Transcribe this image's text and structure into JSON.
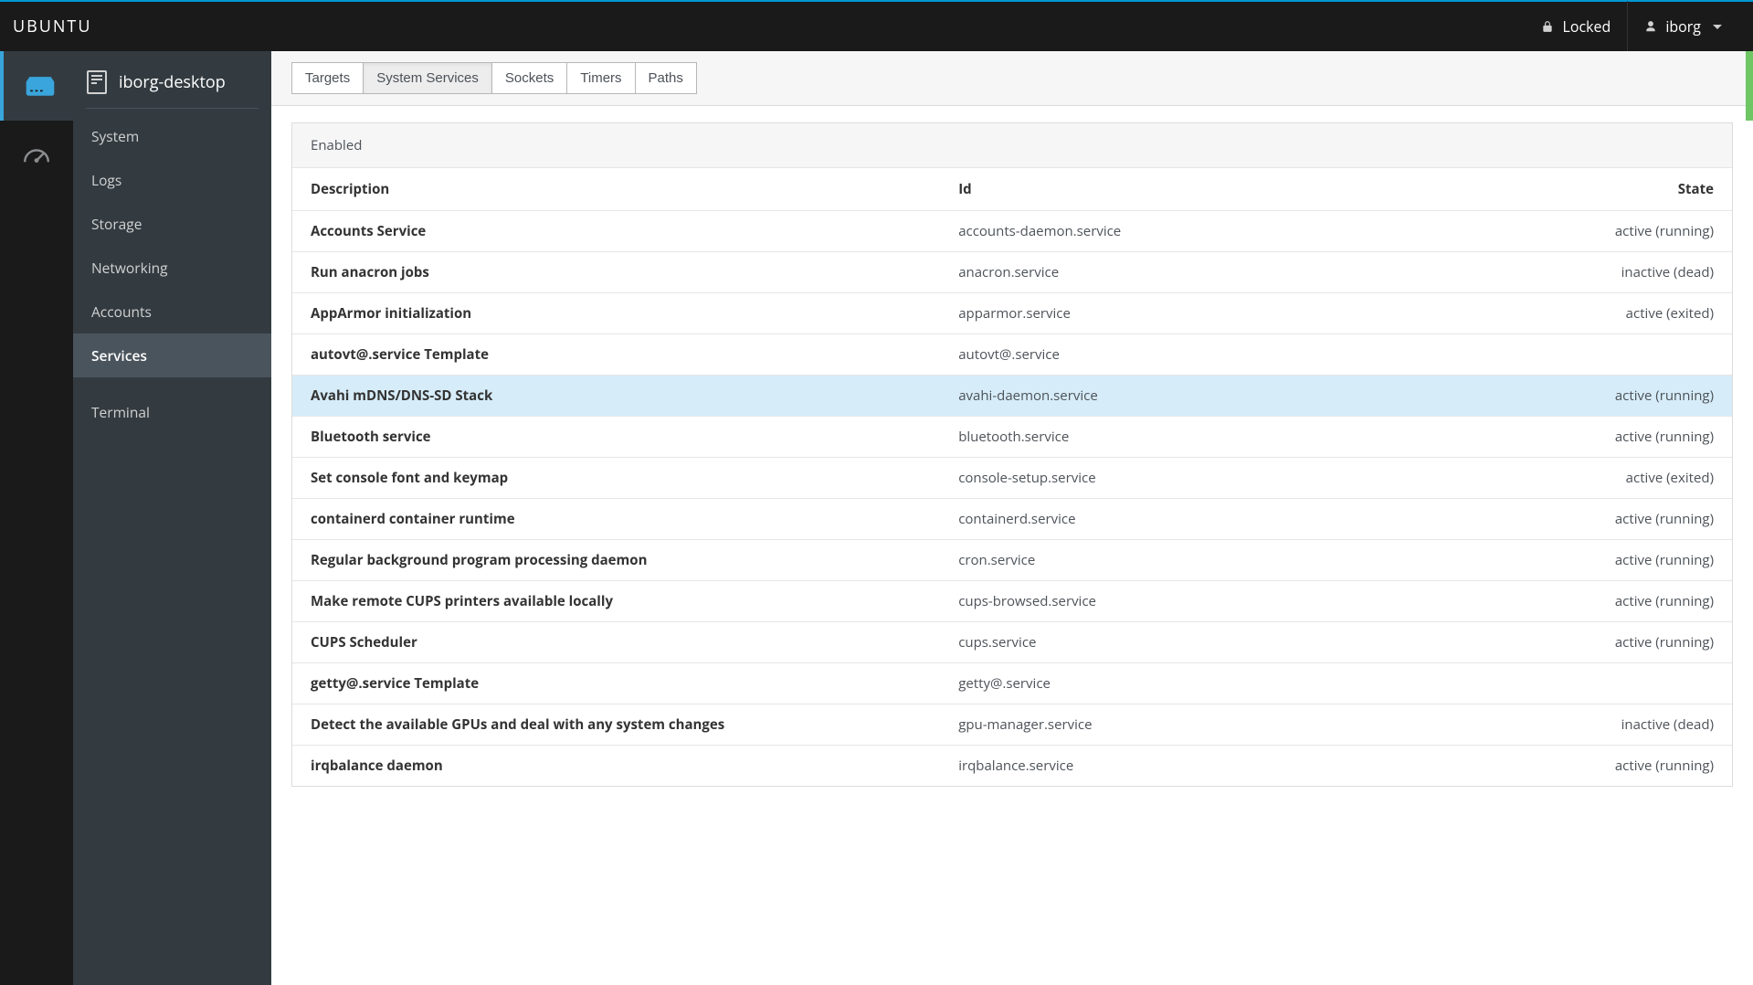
{
  "header": {
    "brand": "UBUNTU",
    "locked_label": "Locked",
    "user": "iborg"
  },
  "sidebar": {
    "hostname": "iborg-desktop",
    "items": [
      {
        "label": "System",
        "key": "system"
      },
      {
        "label": "Logs",
        "key": "logs"
      },
      {
        "label": "Storage",
        "key": "storage"
      },
      {
        "label": "Networking",
        "key": "networking"
      },
      {
        "label": "Accounts",
        "key": "accounts"
      },
      {
        "label": "Services",
        "key": "services",
        "active": true
      },
      {
        "label": "Terminal",
        "key": "terminal"
      }
    ]
  },
  "tabs": [
    {
      "key": "targets",
      "label": "Targets"
    },
    {
      "key": "services",
      "label": "System Services",
      "active": true
    },
    {
      "key": "sockets",
      "label": "Sockets"
    },
    {
      "key": "timers",
      "label": "Timers"
    },
    {
      "key": "paths",
      "label": "Paths"
    }
  ],
  "panel": {
    "title": "Enabled",
    "columns": {
      "description": "Description",
      "id": "Id",
      "state": "State"
    }
  },
  "services": [
    {
      "description": "Accounts Service",
      "id": "accounts-daemon.service",
      "state": "active (running)"
    },
    {
      "description": "Run anacron jobs",
      "id": "anacron.service",
      "state": "inactive (dead)"
    },
    {
      "description": "AppArmor initialization",
      "id": "apparmor.service",
      "state": "active (exited)"
    },
    {
      "description": "autovt@.service Template",
      "id": "autovt@.service",
      "state": ""
    },
    {
      "description": "Avahi mDNS/DNS-SD Stack",
      "id": "avahi-daemon.service",
      "state": "active (running)",
      "highlight": true
    },
    {
      "description": "Bluetooth service",
      "id": "bluetooth.service",
      "state": "active (running)"
    },
    {
      "description": "Set console font and keymap",
      "id": "console-setup.service",
      "state": "active (exited)"
    },
    {
      "description": "containerd container runtime",
      "id": "containerd.service",
      "state": "active (running)"
    },
    {
      "description": "Regular background program processing daemon",
      "id": "cron.service",
      "state": "active (running)"
    },
    {
      "description": "Make remote CUPS printers available locally",
      "id": "cups-browsed.service",
      "state": "active (running)"
    },
    {
      "description": "CUPS Scheduler",
      "id": "cups.service",
      "state": "active (running)"
    },
    {
      "description": "getty@.service Template",
      "id": "getty@.service",
      "state": ""
    },
    {
      "description": "Detect the available GPUs and deal with any system changes",
      "id": "gpu-manager.service",
      "state": "inactive (dead)"
    },
    {
      "description": "irqbalance daemon",
      "id": "irqbalance.service",
      "state": "active (running)"
    }
  ]
}
